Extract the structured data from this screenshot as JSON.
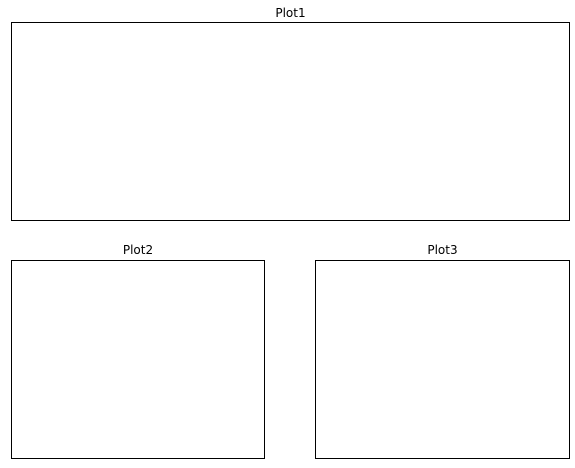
{
  "chart_data": [
    {
      "type": "line",
      "title": "Plot1",
      "xlabel": "",
      "ylabel": "",
      "series": [],
      "axes": "off",
      "grid": false
    },
    {
      "type": "line",
      "title": "Plot2",
      "xlabel": "",
      "ylabel": "",
      "series": [],
      "axes": "off",
      "grid": false
    },
    {
      "type": "line",
      "title": "Plot3",
      "xlabel": "",
      "ylabel": "",
      "series": [],
      "axes": "off",
      "grid": false
    }
  ],
  "colors": {
    "frame": "#000000",
    "background": "#ffffff"
  }
}
